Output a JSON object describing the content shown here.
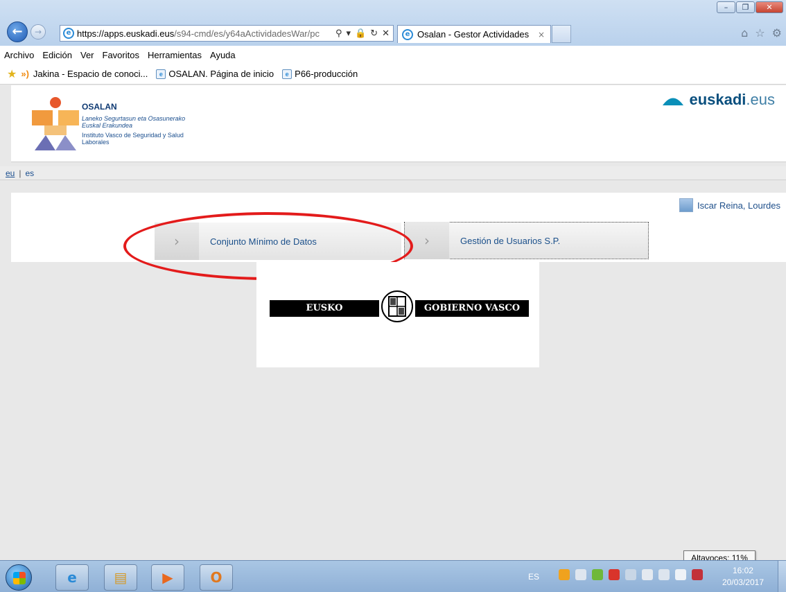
{
  "browser": {
    "url_host": "https://apps.euskadi.eus",
    "url_path": "/s94-cmd/es/y64aActividadesWar/pc",
    "tab_title": "Osalan - Gestor Actividades",
    "tab_close": "×",
    "menu": [
      "Archivo",
      "Edición",
      "Ver",
      "Favoritos",
      "Herramientas",
      "Ayuda"
    ],
    "favorites": [
      "Jakina - Espacio de conoci...",
      "OSALAN. Página de inicio",
      "P66-producción"
    ]
  },
  "header": {
    "org_name": "OSALAN",
    "org_sub_eu": "Laneko Segurtasun eta Osasunerako Euskal Erakundea",
    "org_sub_es": "Instituto Vasco de Seguridad y Salud Laborales",
    "brand_bold": "euskadi",
    "brand_light": ".eus"
  },
  "lang": {
    "eu": "eu",
    "separator": "|",
    "es": "es"
  },
  "user": {
    "name": "Iscar Reina, Lourdes"
  },
  "menu_buttons": [
    {
      "label": "Conjunto Mínimo de Datos"
    },
    {
      "label": "Gestión de Usuarios S.P."
    }
  ],
  "gobierno": {
    "left": "EUSKO JAURLARITZA",
    "right": "GOBIERNO VASCO"
  },
  "taskbar": {
    "tooltip": "Altavoces: 11%",
    "lang": "ES",
    "time": "16:02",
    "date": "20/03/2017"
  },
  "colors": {
    "annotation_red": "#e31b1b",
    "link_blue": "#1a4f8a"
  }
}
